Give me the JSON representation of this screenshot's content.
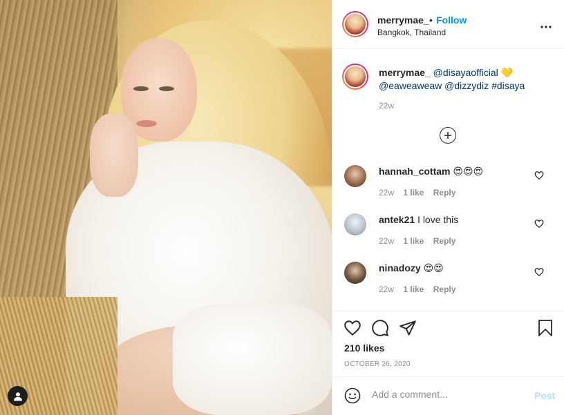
{
  "post": {
    "username": "merrymae_",
    "separator": "•",
    "follow_label": "Follow",
    "location": "Bangkok, Thailand",
    "more_label": "•••",
    "caption": {
      "username": "merrymae_",
      "mention1": "@disayaofficial",
      "emoji": "💛",
      "mention2": "@eaweaweaw",
      "mention3": "@dizzydiz",
      "hashtag": "#disaya",
      "time": "22w"
    },
    "likes": "210 likes",
    "date": "OCTOBER 26, 2020"
  },
  "comments": [
    {
      "username": "hannah_cottam",
      "text": "😍😍😍",
      "time": "22w",
      "likes": "1 like",
      "reply": "Reply"
    },
    {
      "username": "antek21",
      "text": "I love this",
      "time": "22w",
      "likes": "1 like",
      "reply": "Reply"
    },
    {
      "username": "ninadozy",
      "text": "😍😍",
      "time": "22w",
      "likes": "1 like",
      "reply": "Reply"
    }
  ],
  "composer": {
    "placeholder": "Add a comment...",
    "post_label": "Post"
  },
  "icons": [
    "user-tag-icon",
    "plus-circle-icon",
    "heart-icon",
    "comment-icon",
    "share-icon",
    "bookmark-icon",
    "emoji-icon",
    "more-icon"
  ],
  "colors": {
    "link": "#0095f6",
    "mention": "#00376b",
    "muted": "#8e8e8e",
    "post_disabled": "#b2dffc"
  }
}
